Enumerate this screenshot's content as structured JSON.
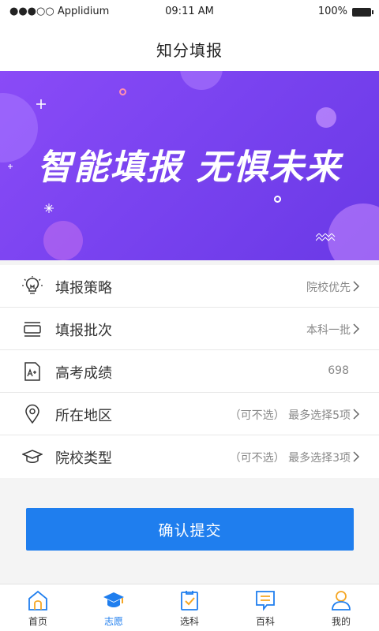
{
  "status_bar": {
    "carrier": "●●●○○ Applidium",
    "time": "09:11 AM",
    "battery": "100%"
  },
  "header": {
    "title": "知分填报"
  },
  "banner": {
    "slogan": "智能填报 无惧未来"
  },
  "settings": [
    {
      "label": "填报策略",
      "value": "院校优先",
      "icon": "lightbulb-icon",
      "chevron": true
    },
    {
      "label": "填报批次",
      "value": "本科一批",
      "icon": "batch-icon",
      "chevron": true
    },
    {
      "label": "高考成绩",
      "value": "698",
      "icon": "score-icon",
      "chevron": false
    },
    {
      "label": "所在地区",
      "value": "（可不选）  最多选择5项",
      "icon": "location-icon",
      "chevron": true
    },
    {
      "label": "院校类型",
      "value": "（可不选）  最多选择3项",
      "icon": "graduation-cap-icon",
      "chevron": true
    }
  ],
  "submit": {
    "label": "确认提交"
  },
  "tab_bar": {
    "tabs": [
      {
        "label": "首页",
        "icon": "home-icon"
      },
      {
        "label": "志愿",
        "icon": "graduation-cap-icon"
      },
      {
        "label": "选科",
        "icon": "checklist-icon"
      },
      {
        "label": "百科",
        "icon": "chat-doc-icon"
      },
      {
        "label": "我的",
        "icon": "user-icon"
      }
    ],
    "active_index": 1
  },
  "colors": {
    "accent": "#1f7eee",
    "banner_start": "#8a4bf7",
    "banner_end": "#6a39e6",
    "icon_orange": "#f5a623"
  }
}
